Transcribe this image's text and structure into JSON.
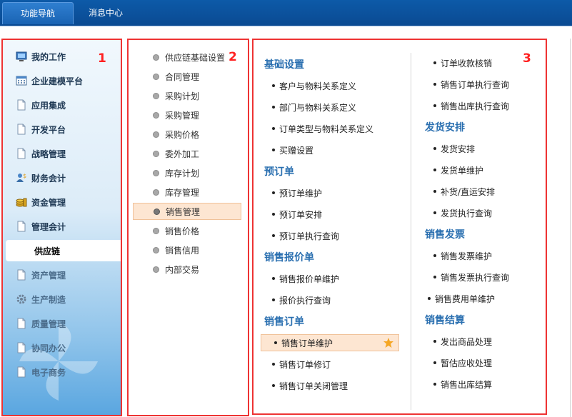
{
  "tabs": [
    {
      "label": "功能导航"
    },
    {
      "label": "消息中心"
    }
  ],
  "panel_numbers": [
    "1",
    "2",
    "3"
  ],
  "sidebar": {
    "items": [
      {
        "label": "我的工作",
        "icon": "desktop-icon"
      },
      {
        "label": "企业建模平台",
        "icon": "grid-icon"
      },
      {
        "label": "应用集成",
        "icon": "document-icon"
      },
      {
        "label": "开发平台",
        "icon": "document-icon"
      },
      {
        "label": "战略管理",
        "icon": "document-icon"
      },
      {
        "label": "财务会计",
        "icon": "users-money-icon"
      },
      {
        "label": "资金管理",
        "icon": "coins-icon"
      },
      {
        "label": "管理会计",
        "icon": "document-icon"
      },
      {
        "label": "供应链",
        "icon": "none"
      },
      {
        "label": "资产管理",
        "icon": "document-icon"
      },
      {
        "label": "生产制造",
        "icon": "gear-icon"
      },
      {
        "label": "质量管理",
        "icon": "document-icon"
      },
      {
        "label": "协同办公",
        "icon": "document-icon"
      },
      {
        "label": "电子商务",
        "icon": "document-icon"
      }
    ],
    "selected": "供应链"
  },
  "modules": {
    "items": [
      "供应链基础设置",
      "合同管理",
      "采购计划",
      "采购管理",
      "采购价格",
      "委外加工",
      "库存计划",
      "库存管理",
      "销售管理",
      "销售价格",
      "销售信用",
      "内部交易"
    ],
    "selected": "销售管理"
  },
  "functions": {
    "left": [
      {
        "section": "基础设置",
        "items": [
          "客户与物料关系定义",
          "部门与物料关系定义",
          "订单类型与物料关系定义",
          "买赠设置"
        ]
      },
      {
        "section": "预订单",
        "items": [
          "预订单维护",
          "预订单安排",
          "预订单执行查询"
        ]
      },
      {
        "section": "销售报价单",
        "items": [
          "销售报价单维护",
          "报价执行查询"
        ]
      },
      {
        "section": "销售订单",
        "items": [
          "销售订单维护",
          "销售订单修订",
          "销售订单关闭管理"
        ]
      }
    ],
    "right_top_items": [
      "订单收款核销",
      "销售订单执行查询",
      "销售出库执行查询"
    ],
    "right": [
      {
        "section": "发货安排",
        "items": [
          "发货安排",
          "发货单维护",
          "补货/直运安排",
          "发货执行查询"
        ]
      },
      {
        "section": "销售发票",
        "items": [
          "销售发票维护",
          "销售发票执行查询",
          "销售费用单维护"
        ]
      },
      {
        "section": "销售结算",
        "items": [
          "发出商品处理",
          "暂估应收处理",
          "销售出库结算"
        ]
      }
    ],
    "selected": "销售订单维护",
    "accent_color": "#2a6fb0",
    "highlight_color": "#fde6d2",
    "star_color": "#f5a623"
  }
}
